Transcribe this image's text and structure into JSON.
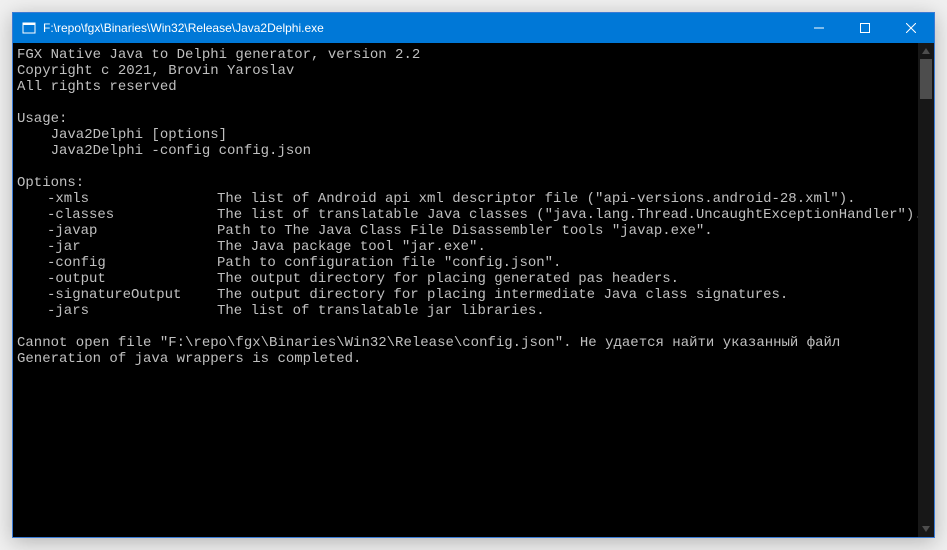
{
  "window": {
    "title": "F:\\repo\\fgx\\Binaries\\Win32\\Release\\Java2Delphi.exe"
  },
  "header": {
    "line1": "FGX Native Java to Delphi generator, version 2.2",
    "line2": "Copyright c 2021, Brovin Yaroslav",
    "line3": "All rights reserved"
  },
  "usage": {
    "heading": "Usage:",
    "line1": "    Java2Delphi [options]",
    "line2": "    Java2Delphi -config config.json"
  },
  "options": {
    "heading": "Options:",
    "rows": [
      {
        "flag": "-xmls",
        "desc": "The list of Android api xml descriptor file (\"api-versions.android-28.xml\")."
      },
      {
        "flag": "-classes",
        "desc": "The list of translatable Java classes (\"java.lang.Thread.UncaughtExceptionHandler\")."
      },
      {
        "flag": "-javap",
        "desc": "Path to The Java Class File Disassembler tools \"javap.exe\"."
      },
      {
        "flag": "-jar",
        "desc": "The Java package tool \"jar.exe\"."
      },
      {
        "flag": "-config",
        "desc": "Path to configuration file \"config.json\"."
      },
      {
        "flag": "-output",
        "desc": "The output directory for placing generated pas headers."
      },
      {
        "flag": "-signatureOutput",
        "desc": "The output directory for placing intermediate Java class signatures."
      },
      {
        "flag": "-jars",
        "desc": "The list of translatable jar libraries."
      }
    ]
  },
  "footer": {
    "error": "Cannot open file \"F:\\repo\\fgx\\Binaries\\Win32\\Release\\config.json\". Не удается найти указанный файл",
    "done": "Generation of java wrappers is completed."
  }
}
